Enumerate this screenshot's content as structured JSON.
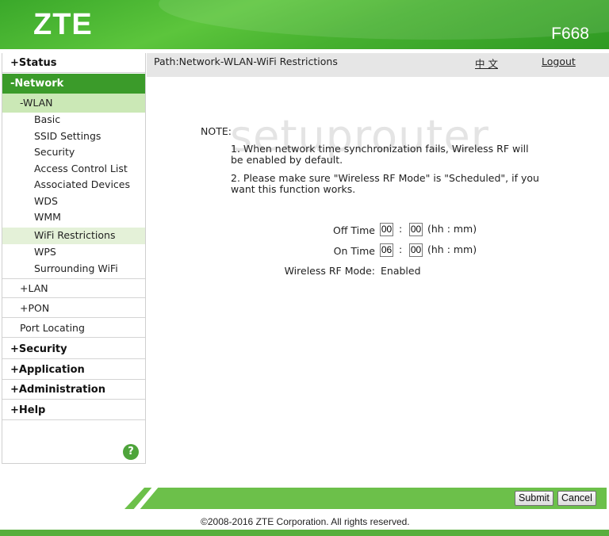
{
  "header": {
    "logo": "ZTE",
    "model": "F668"
  },
  "sidebar": {
    "status": "+Status",
    "network": "-Network",
    "wlan": "-WLAN",
    "leaves": [
      "Basic",
      "SSID Settings",
      "Security",
      "Access Control List",
      "Associated Devices",
      "WDS",
      "WMM",
      "WiFi Restrictions",
      "WPS",
      "Surrounding WiFi"
    ],
    "lan": "+LAN",
    "pon": "+PON",
    "port_locating": "Port Locating",
    "security": "+Security",
    "application": "+Application",
    "administration": "+Administration",
    "help": "+Help",
    "help_button": "?"
  },
  "pathbar": {
    "path": "Path:Network-WLAN-WiFi Restrictions",
    "language": "中 文",
    "logout": "Logout"
  },
  "watermark": "setuprouter",
  "note": {
    "label": "NOTE:",
    "line1": "1. When network time synchronization fails, Wireless RF will be enabled by default.",
    "line2": "2. Please make sure \"Wireless RF Mode\" is \"Scheduled\", if you want this function works."
  },
  "form": {
    "off_time_label": "Off Time",
    "off_hh": "00",
    "off_mm": "00",
    "on_time_label": "On Time",
    "on_hh": "06",
    "on_mm": "00",
    "colon": ":",
    "hint": "(hh : mm)",
    "rf_mode_label": "Wireless RF Mode:",
    "rf_mode_value": "Enabled"
  },
  "buttons": {
    "submit": "Submit",
    "cancel": "Cancel"
  },
  "footer": {
    "copyright": "©2008-2016 ZTE Corporation. All rights reserved."
  },
  "colors": {
    "brand_green": "#46b02f",
    "nav_active": "#3b9b2a",
    "footer_green": "#6cc04a"
  }
}
